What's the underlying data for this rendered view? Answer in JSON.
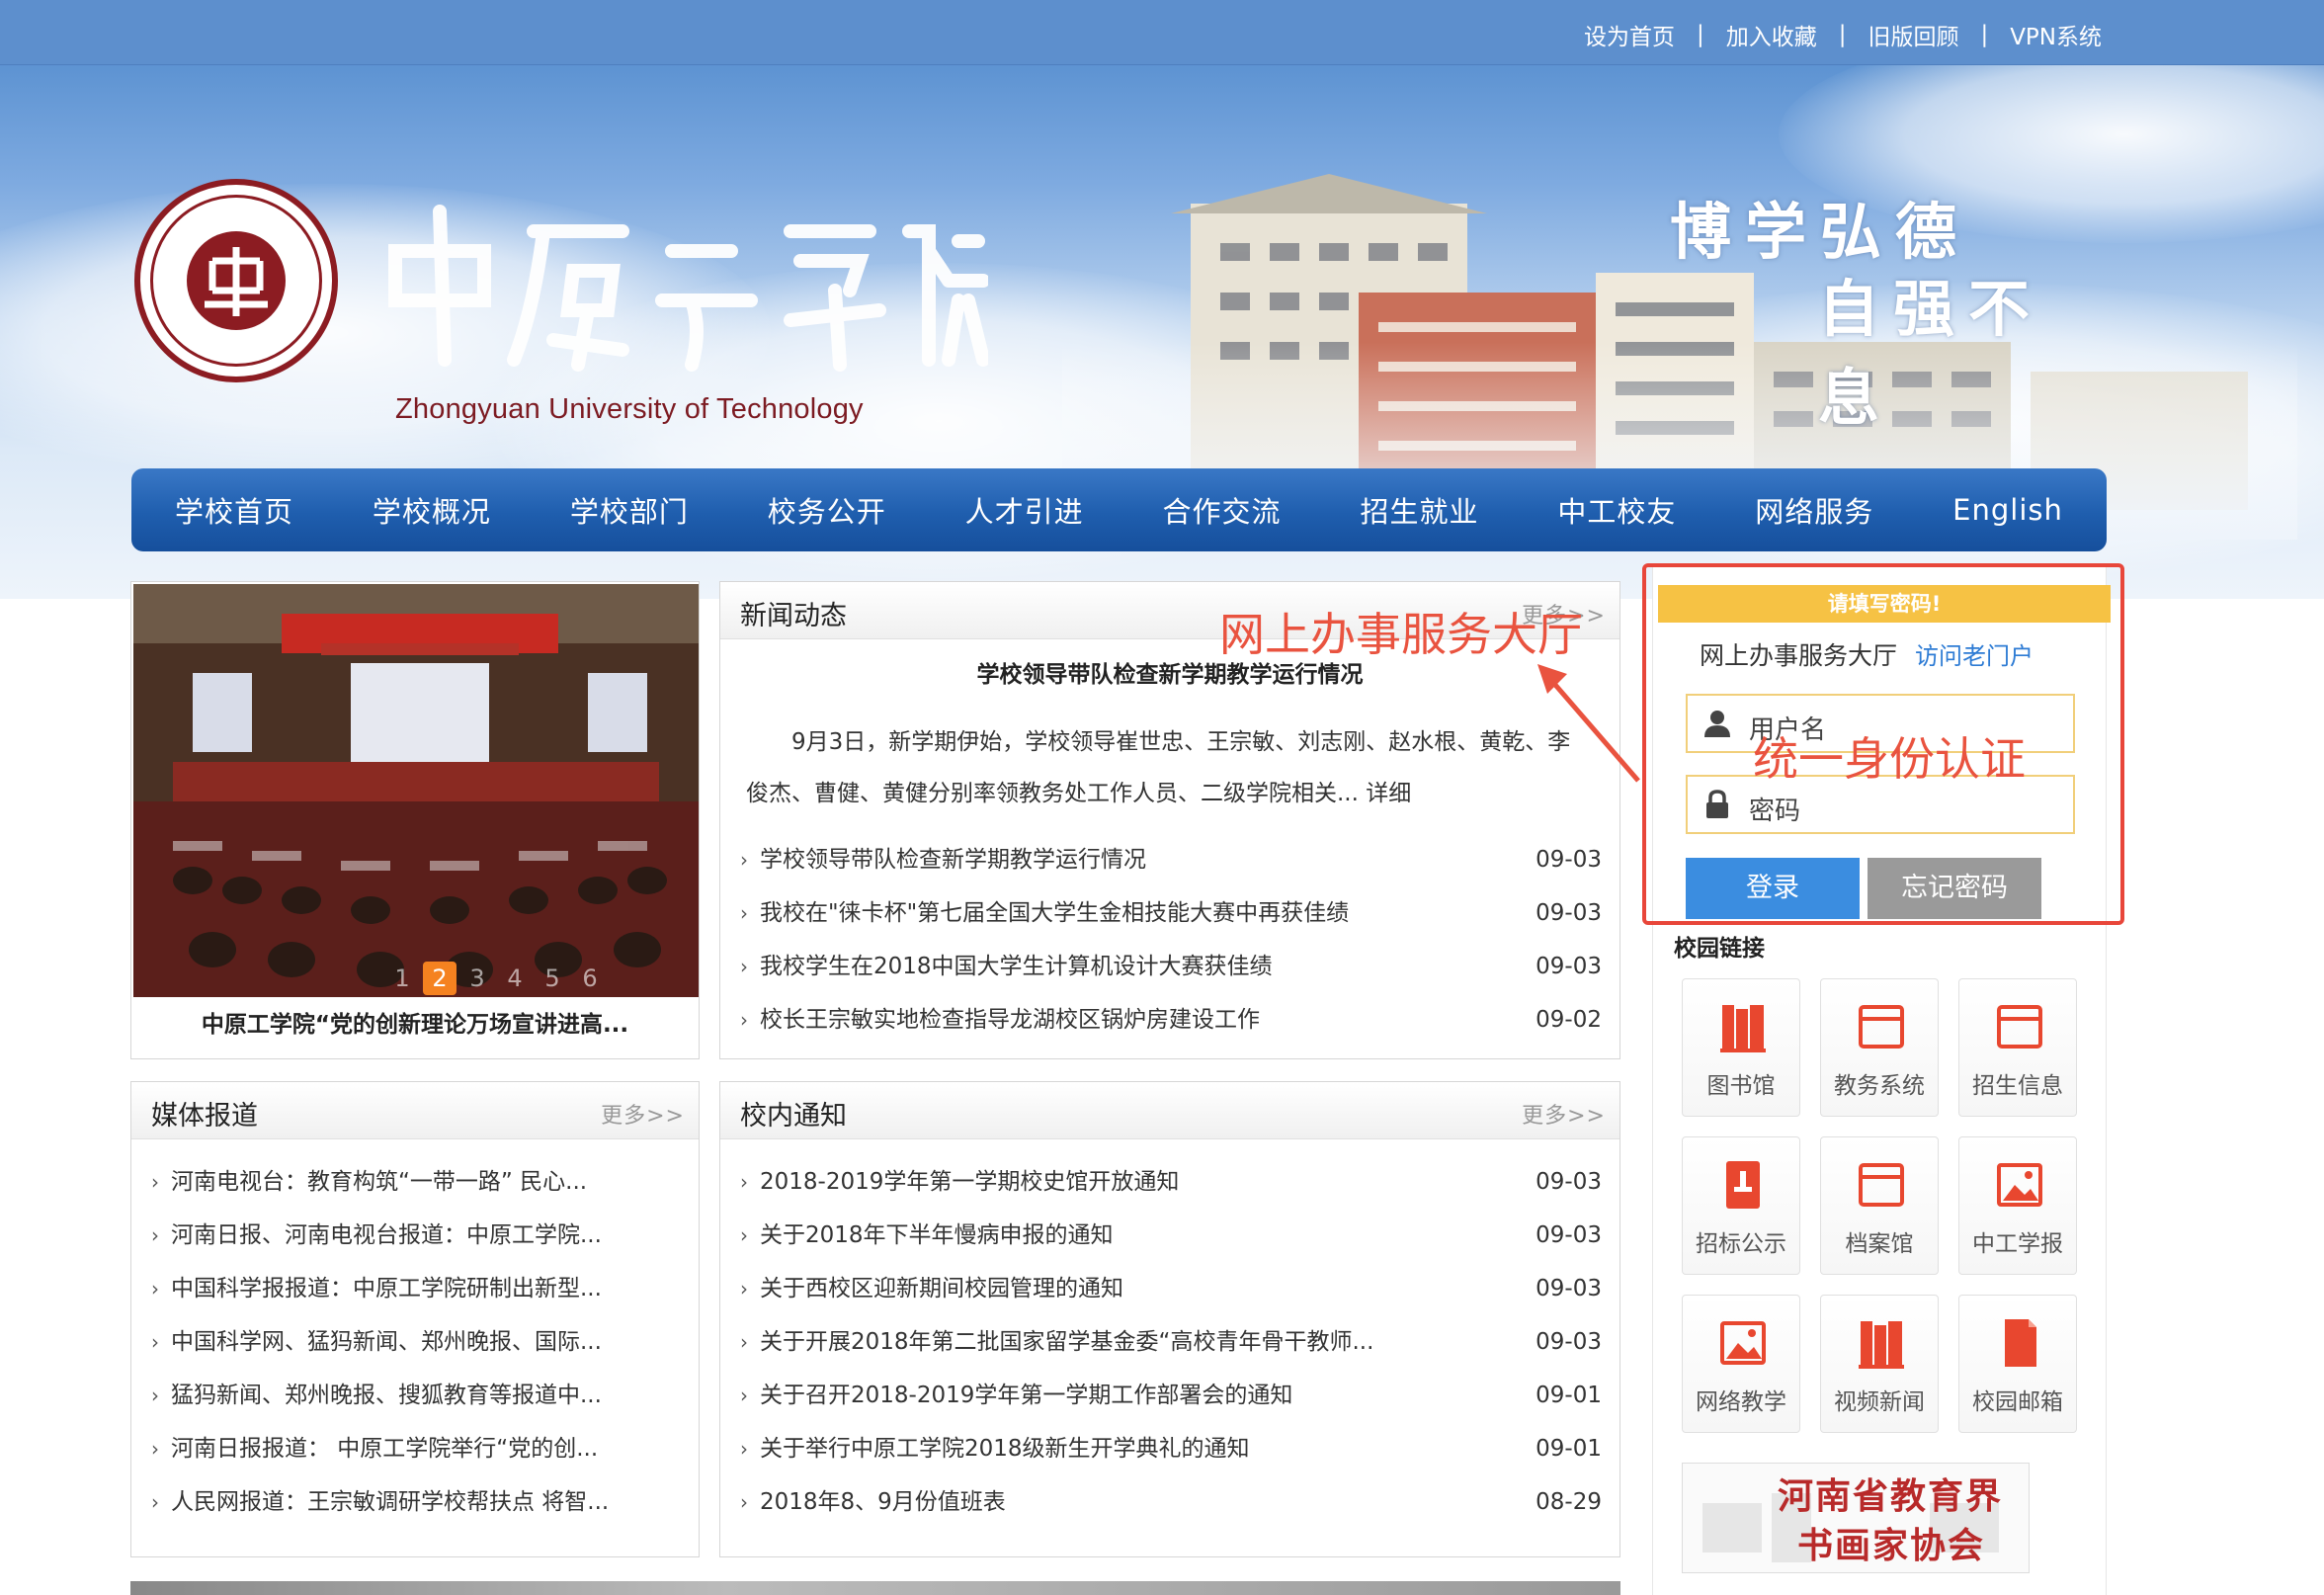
{
  "toplinks": [
    "设为首页",
    "加入收藏",
    "旧版回顾",
    "VPN系统"
  ],
  "toplinks_sep": "|",
  "brand": {
    "name_en": "Zhongyuan University of Technology",
    "motto_line1": "博学弘德",
    "motto_line2": "自强不息"
  },
  "nav": [
    "学校首页",
    "学校概况",
    "学校部门",
    "校务公开",
    "人才引进",
    "合作交流",
    "招生就业",
    "中工校友",
    "网络服务",
    "English"
  ],
  "slider": {
    "caption": "中原工学院“党的创新理论万场宣讲进高...",
    "dots": [
      "1",
      "2",
      "3",
      "4",
      "5",
      "6"
    ],
    "active_dot": "2"
  },
  "news": {
    "title": "新闻动态",
    "more": "更多>>",
    "headline": "学校领导带队检查新学期教学运行情况",
    "summary": "9月3日，新学期伊始，学校领导崔世忠、王宗敏、刘志刚、赵水根、黄乾、李俊杰、曹健、黄健分别率领教务处工作人员、二级学院相关...",
    "detail": "详细",
    "items": [
      {
        "text": "学校领导带队检查新学期教学运行情况",
        "date": "09-03"
      },
      {
        "text": "我校在\"徕卡杯\"第七届全国大学生金相技能大赛中再获佳绩",
        "date": "09-03"
      },
      {
        "text": "我校学生在2018中国大学生计算机设计大赛获佳绩",
        "date": "09-03"
      },
      {
        "text": "校长王宗敏实地检查指导龙湖校区锅炉房建设工作",
        "date": "09-02"
      }
    ]
  },
  "media": {
    "title": "媒体报道",
    "more": "更多>>",
    "items": [
      "河南电视台：教育构筑“一带一路” 民心...",
      "河南日报、河南电视台报道：中原工学院...",
      "中国科学报报道：中原工学院研制出新型...",
      "中国科学网、猛犸新闻、郑州晚报、国际...",
      "猛犸新闻、郑州晚报、搜狐教育等报道中...",
      "河南日报报道： 中原工学院举行“党的创...",
      "人民网报道：王宗敏调研学校帮扶点 将智..."
    ]
  },
  "notice": {
    "title": "校内通知",
    "more": "更多>>",
    "items": [
      {
        "text": "2018-2019学年第一学期校史馆开放通知",
        "date": "09-03"
      },
      {
        "text": "关于2018年下半年慢病申报的通知",
        "date": "09-03"
      },
      {
        "text": "关于西校区迎新期间校园管理的通知",
        "date": "09-03"
      },
      {
        "text": "关于开展2018年第二批国家留学基金委“高校青年骨干教师...",
        "date": "09-03"
      },
      {
        "text": "关于召开2018-2019学年第一学期工作部署会的通知",
        "date": "09-01"
      },
      {
        "text": "关于举行中原工学院2018级新生开学典礼的通知",
        "date": "09-01"
      },
      {
        "text": "2018年8、9月份值班表",
        "date": "08-29"
      }
    ]
  },
  "login": {
    "header": "请填写密码!",
    "hall": "网上办事服务大厅",
    "visit": "访问老门户",
    "username_placeholder": "用户名",
    "password_placeholder": "密码",
    "login_btn": "登录",
    "forgot_btn": "忘记密码"
  },
  "annotations": {
    "hall": "网上办事服务大厅",
    "auth": "统一身份认证",
    "color": "#e9533f"
  },
  "campus_links": {
    "title": "校园链接",
    "tiles": [
      {
        "label": "图书馆",
        "icon": "library-icon"
      },
      {
        "label": "教务系统",
        "icon": "academic-system-icon"
      },
      {
        "label": "招生信息",
        "icon": "admission-icon"
      },
      {
        "label": "招标公示",
        "icon": "bidding-icon"
      },
      {
        "label": "档案馆",
        "icon": "archive-icon"
      },
      {
        "label": "中工学报",
        "icon": "journal-icon"
      },
      {
        "label": "网络教学",
        "icon": "online-teaching-icon"
      },
      {
        "label": "视频新闻",
        "icon": "video-news-icon"
      },
      {
        "label": "校园邮箱",
        "icon": "mail-icon"
      }
    ],
    "icon_color": "#e8472f"
  },
  "association": {
    "line1": "河南省教育界",
    "line2": "书画家协会"
  },
  "colors": {
    "topbar": "#5d8fcd",
    "nav": "#1f5eae",
    "brand_red": "#8c1c22",
    "login_btn": "#3b8de0",
    "highlight": "#f58220"
  }
}
